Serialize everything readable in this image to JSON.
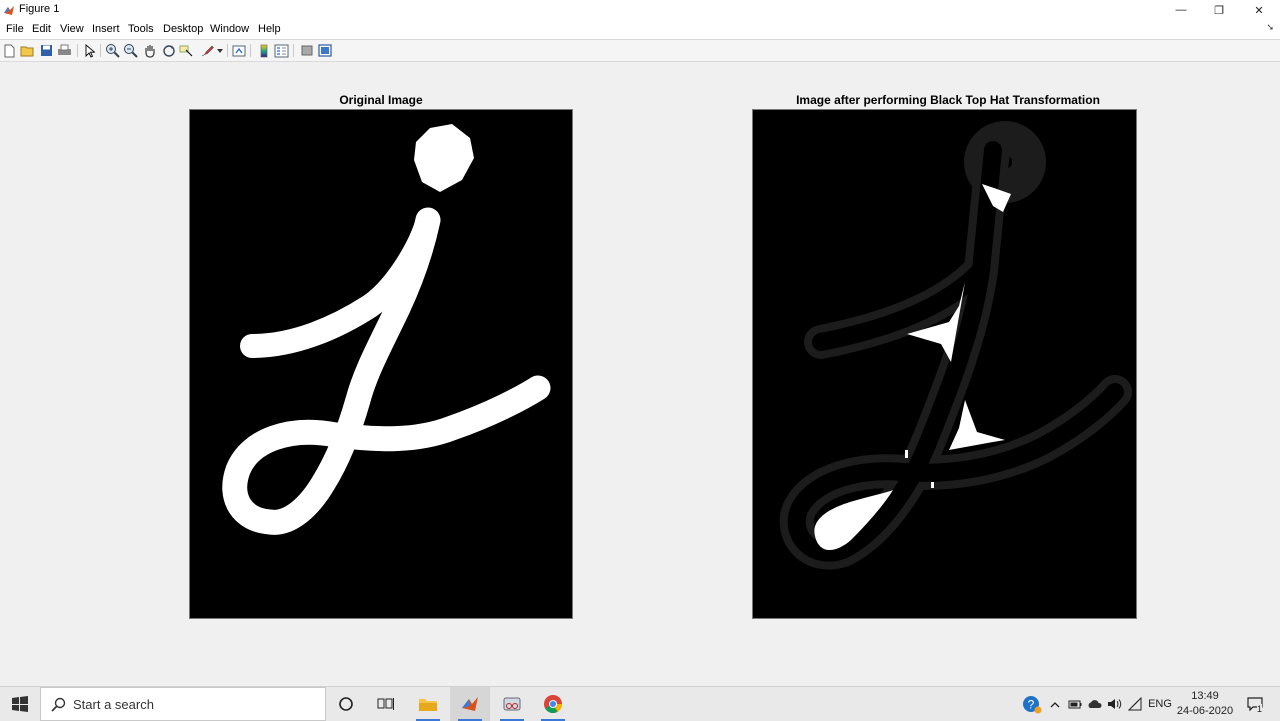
{
  "window": {
    "title": "Figure 1",
    "minimize_glyph": "—",
    "restore_glyph": "❐",
    "close_glyph": "✕"
  },
  "menu": {
    "items": [
      "File",
      "Edit",
      "View",
      "Insert",
      "Tools",
      "Desktop",
      "Window",
      "Help"
    ],
    "undock_glyph": "➘"
  },
  "toolbar": {
    "buttons": [
      "new-figure-icon",
      "open-file-icon",
      "save-icon",
      "print-icon",
      "edit-plot-arrow-icon",
      "zoom-in-icon",
      "zoom-out-icon",
      "pan-hand-icon",
      "rotate-3d-icon",
      "data-cursor-icon",
      "brush-icon",
      "link-plot-icon",
      "colorbar-icon",
      "legend-icon",
      "hide-plot-tools-icon",
      "show-plot-tools-icon"
    ]
  },
  "figure": {
    "subplots": [
      {
        "title": "Original Image"
      },
      {
        "title": "Image after performing Black Top Hat Transformation"
      }
    ]
  },
  "taskbar": {
    "search_placeholder": "Start a search",
    "apps": [
      "cortana-icon",
      "task-view-icon",
      "file-explorer-icon",
      "matlab-icon",
      "snipping-tool-icon",
      "chrome-icon"
    ],
    "tray": {
      "language": "ENG",
      "time": "13:49",
      "date": "24-06-2020",
      "notification_count": "1"
    }
  },
  "colors": {
    "figure_bg": "#f0f0f0",
    "axes_bg": "#000000",
    "stroke": "#ffffff",
    "taskbar_bg": "#e9e9e9"
  }
}
